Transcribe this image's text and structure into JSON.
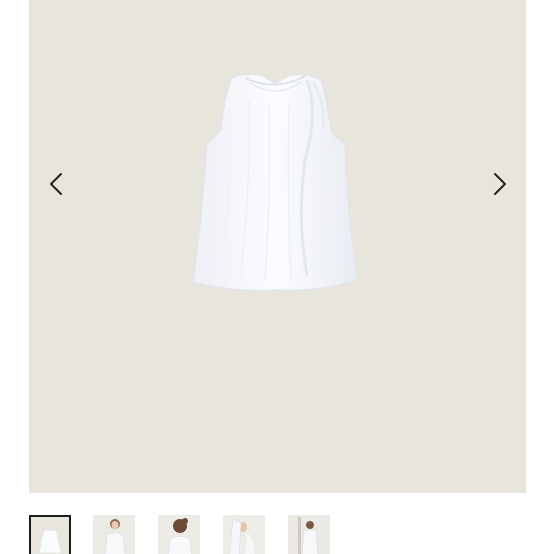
{
  "gallery": {
    "background_color": "#e8e6dc",
    "main_image": {
      "description_icon": "sleeveless-white-blouse",
      "garment_color": "#fafbfd"
    },
    "prev_icon": "chevron-left-icon",
    "next_icon": "chevron-right-icon"
  },
  "thumbnails": [
    {
      "icon": "sleeveless-white-blouse",
      "active": true
    },
    {
      "icon": "model-front-view",
      "active": false
    },
    {
      "icon": "model-back-view",
      "active": false
    },
    {
      "icon": "model-side-detail",
      "active": false
    },
    {
      "icon": "model-full-length",
      "active": false
    }
  ]
}
